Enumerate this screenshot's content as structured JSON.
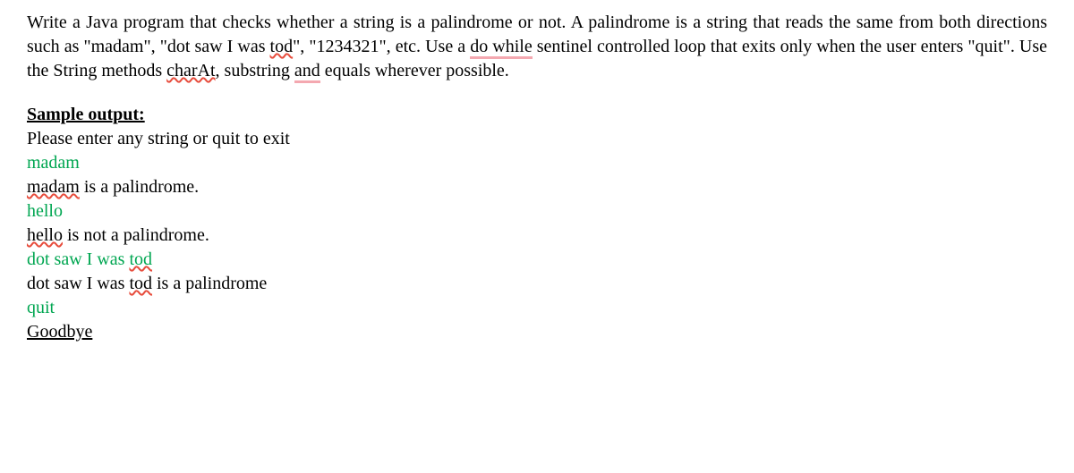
{
  "problem": {
    "p1a": "Write a Java program that checks whether a string is a palindrome or not. A palindrome is a string that reads the same from both directions such as \"madam\", \"dot saw I was ",
    "p1_tod": "tod",
    "p1b": "\", \"1234321\", etc. Use a ",
    "p1_dowhile": "do while",
    "p2a": " sentinel controlled loop that exits only when the user enters \"quit\". Use the String methods ",
    "p2_charat": "charAt",
    "p2b": ", substring ",
    "p2_and": "and",
    "p2c": " equals wherever possible."
  },
  "sample": {
    "heading": "Sample output:",
    "prompt": "Please enter any string or quit to exit",
    "in1": "madam",
    "out1a": "madam",
    "out1b": " is a palindrome.",
    "in2": "hello",
    "out2a": "hello",
    "out2b": " is not a palindrome.",
    "in3a": "dot saw I was ",
    "in3b": "tod",
    "out3a": "dot saw I was ",
    "out3b": "tod",
    "out3c": " is a palindrome",
    "in4": "quit",
    "out4": "Goodbye"
  }
}
